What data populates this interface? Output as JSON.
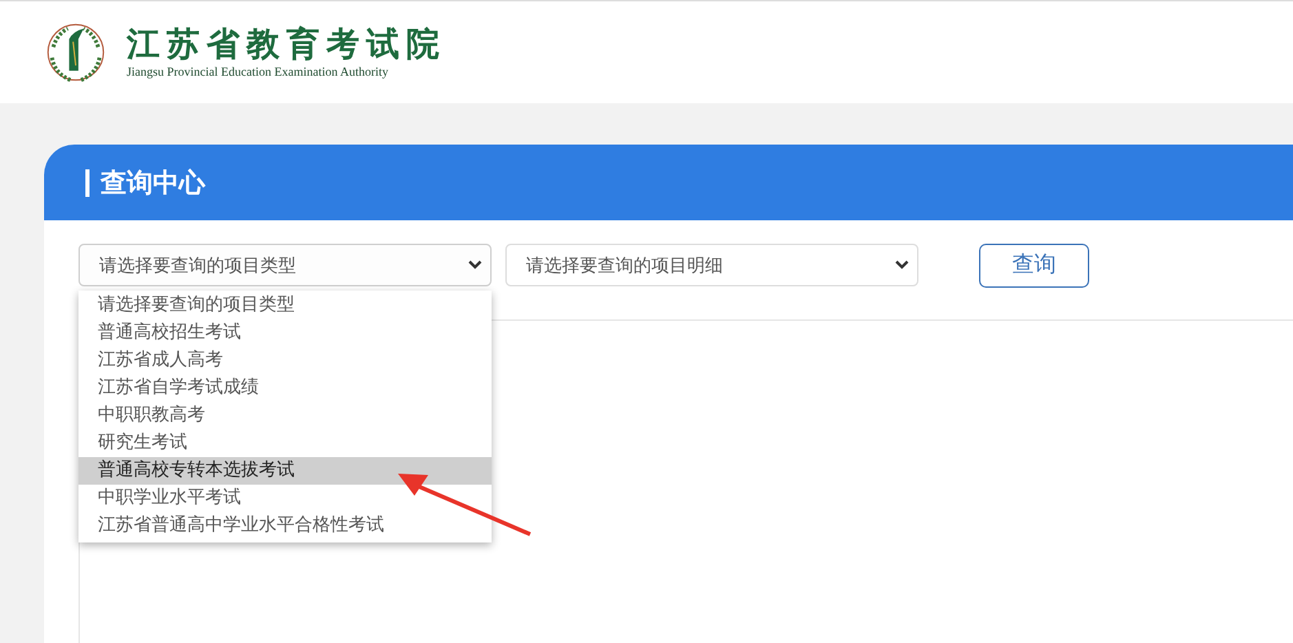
{
  "header": {
    "logo_title": "江苏省教育考试院",
    "logo_subtitle": "Jiangsu Provincial Education Examination Authority"
  },
  "panel": {
    "title": "查询中心",
    "type_select": {
      "value": "请选择要查询的项目类型",
      "expanded": true
    },
    "detail_select": {
      "value": "请选择要查询的项目明细"
    },
    "query_button": "查询",
    "type_options": [
      {
        "label": "请选择要查询的项目类型",
        "selected": false
      },
      {
        "label": "普通高校招生考试",
        "selected": false
      },
      {
        "label": "江苏省成人高考",
        "selected": false
      },
      {
        "label": "江苏省自学考试成绩",
        "selected": false
      },
      {
        "label": "中职职教高考",
        "selected": false
      },
      {
        "label": "研究生考试",
        "selected": false
      },
      {
        "label": "普通高校专转本选拔考试",
        "selected": true
      },
      {
        "label": "中职学业水平考试",
        "selected": false
      },
      {
        "label": "江苏省普通高中学业水平合格性考试",
        "selected": false
      }
    ]
  }
}
